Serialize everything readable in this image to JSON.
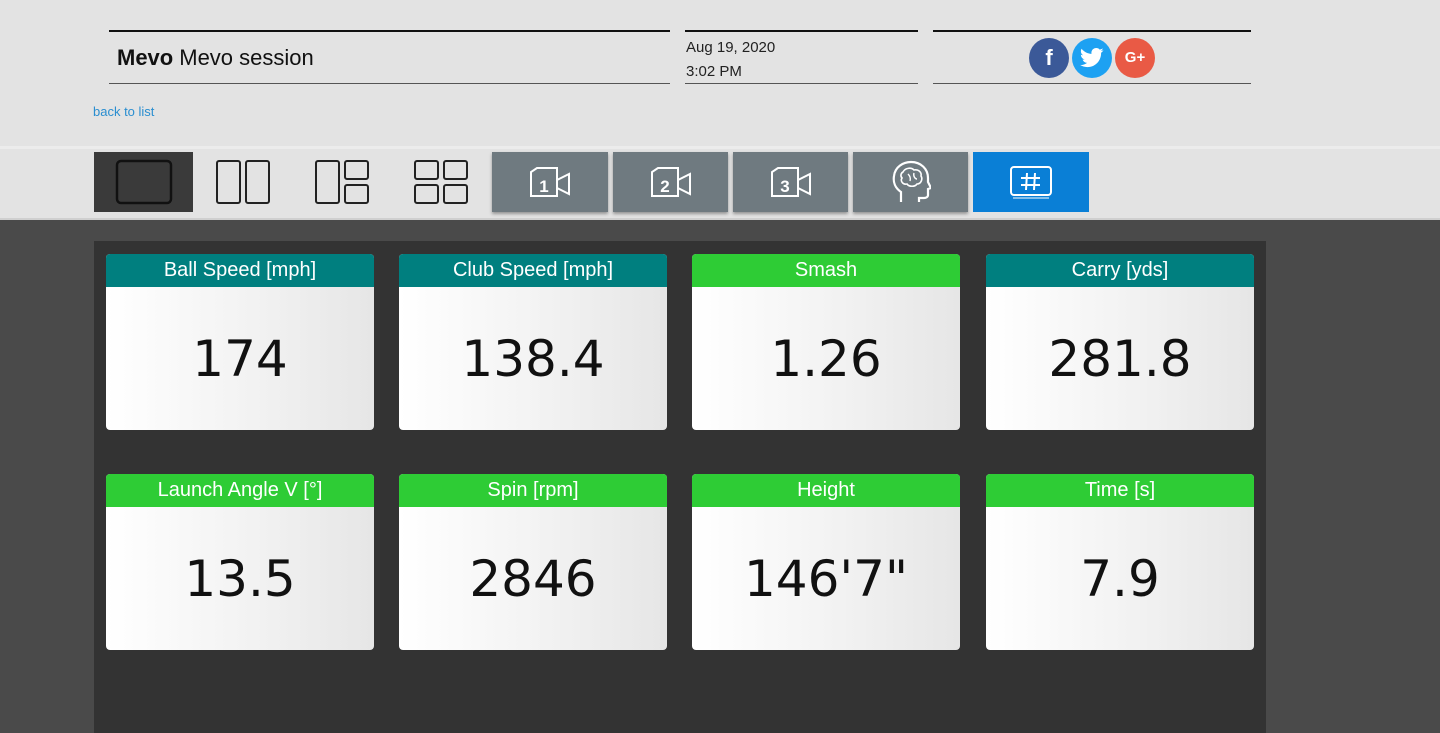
{
  "header": {
    "brand": "Mevo",
    "session_title": "Mevo session",
    "date": "Aug 19, 2020",
    "time": "3:02 PM",
    "back_link": "back to list",
    "social": [
      {
        "name": "facebook",
        "glyph": "f",
        "color": "#3b5998"
      },
      {
        "name": "twitter",
        "glyph": "twitter-bird",
        "color": "#1da1f2"
      },
      {
        "name": "google-plus",
        "glyph": "G+",
        "color": "#e95a45"
      }
    ]
  },
  "toolbar": {
    "buttons": [
      {
        "name": "layout-single",
        "icon": "single-pane-icon",
        "active": true
      },
      {
        "name": "layout-two",
        "icon": "two-pane-icon"
      },
      {
        "name": "layout-three",
        "icon": "three-pane-icon"
      },
      {
        "name": "layout-four",
        "icon": "four-pane-icon"
      },
      {
        "name": "camera-1",
        "icon": "camera-icon",
        "label": "1"
      },
      {
        "name": "camera-2",
        "icon": "camera-icon",
        "label": "2"
      },
      {
        "name": "camera-3",
        "icon": "camera-icon",
        "label": "3"
      },
      {
        "name": "insights",
        "icon": "brain-icon"
      },
      {
        "name": "data-grid",
        "icon": "hash-icon",
        "selected": true
      }
    ]
  },
  "colors": {
    "teal": "#007f7f",
    "green": "#2ecc35",
    "blue": "#0a7fd6",
    "camera_gray": "#6f7a80"
  },
  "metrics": [
    {
      "label": "Ball Speed [mph]",
      "value": "174",
      "color": "teal"
    },
    {
      "label": "Club Speed [mph]",
      "value": "138.4",
      "color": "teal"
    },
    {
      "label": "Smash",
      "value": "1.26",
      "color": "green"
    },
    {
      "label": "Carry [yds]",
      "value": "281.8",
      "color": "teal"
    },
    {
      "label": "Launch Angle V [°]",
      "value": "13.5",
      "color": "green"
    },
    {
      "label": "Spin [rpm]",
      "value": "2846",
      "color": "green"
    },
    {
      "label": "Height",
      "value": "146'7\"",
      "color": "green"
    },
    {
      "label": "Time [s]",
      "value": "7.9",
      "color": "green"
    }
  ]
}
